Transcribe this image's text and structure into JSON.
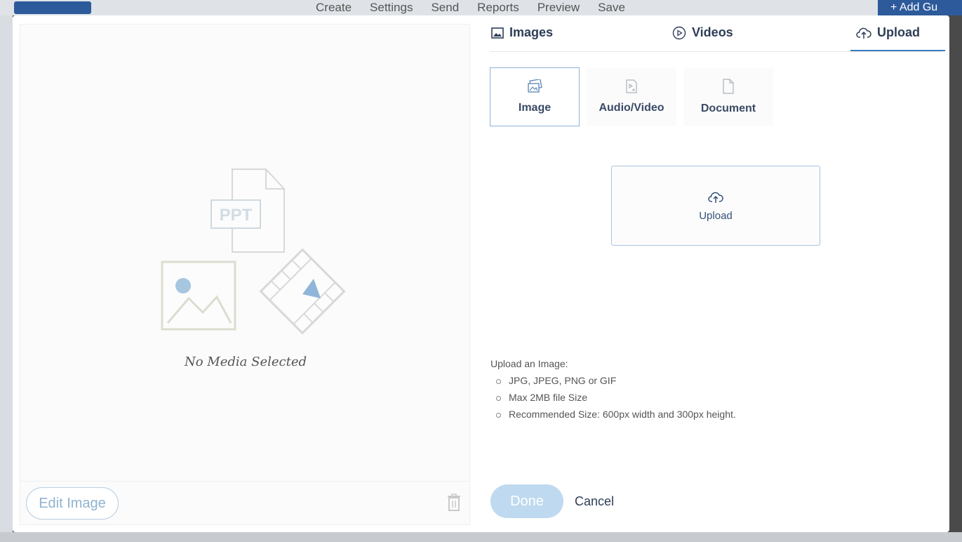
{
  "background": {
    "toolbar": [
      "Create",
      "Settings",
      "Send",
      "Reports",
      "Preview",
      "Save"
    ],
    "add_button": "+ Add Gu"
  },
  "left_pane": {
    "placeholder_badge": "PPT",
    "no_media_text": "No Media Selected",
    "edit_button": "Edit Image"
  },
  "tabs": [
    {
      "label": "Images",
      "icon": "image-icon"
    },
    {
      "label": "Videos",
      "icon": "play-circle-icon"
    },
    {
      "label": "Upload",
      "icon": "cloud-upload-icon",
      "active": true
    }
  ],
  "subtabs": [
    {
      "label": "Image",
      "icon": "image-icon",
      "active": true
    },
    {
      "label": "Audio/Video",
      "icon": "media-file-icon"
    },
    {
      "label": "Document",
      "icon": "document-icon"
    }
  ],
  "upload_box": {
    "label": "Upload"
  },
  "info": {
    "heading": "Upload an Image:",
    "items": [
      "JPG, JPEG, PNG or GIF",
      "Max 2MB file Size",
      "Recommended Size: 600px width and 300px height."
    ]
  },
  "footer": {
    "done": "Done",
    "cancel": "Cancel"
  },
  "colors": {
    "accent": "#3a7cc2",
    "done_bg": "#bfdaf0",
    "border_light": "#8cb3d9"
  }
}
